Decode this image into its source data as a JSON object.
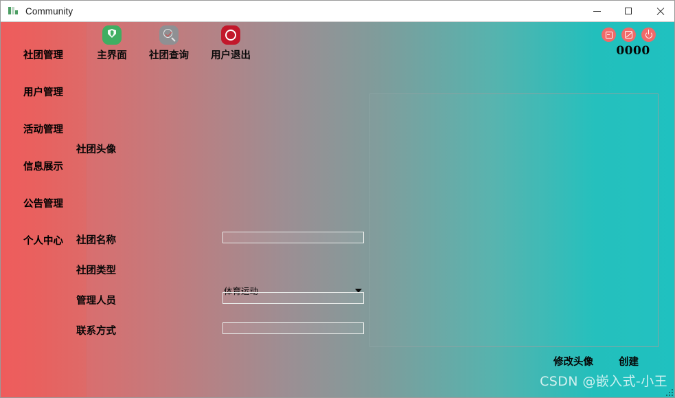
{
  "window": {
    "title": "Community",
    "icon": "app-block-icon",
    "controls": {
      "minimize": "minimize-icon",
      "maximize": "maximize-icon",
      "close": "close-icon"
    }
  },
  "sidebar": {
    "items": [
      {
        "label": "社团管理",
        "name": "sidebar-item-club-management"
      },
      {
        "label": "用户管理",
        "name": "sidebar-item-user-management"
      },
      {
        "label": "活动管理",
        "name": "sidebar-item-activity-management"
      },
      {
        "label": "信息展示",
        "name": "sidebar-item-information-display"
      },
      {
        "label": "公告管理",
        "name": "sidebar-item-announcement-management"
      },
      {
        "label": "个人中心",
        "name": "sidebar-item-personal-center"
      }
    ]
  },
  "toolbar": {
    "buttons": [
      {
        "label": "主界面",
        "icon": "shield-icon"
      },
      {
        "label": "社团查询",
        "icon": "search-icon"
      },
      {
        "label": "用户退出",
        "icon": "record-icon"
      }
    ]
  },
  "corner": {
    "buttons": [
      {
        "icon": "window-minimize-icon"
      },
      {
        "icon": "window-restore-icon"
      },
      {
        "icon": "power-icon"
      }
    ],
    "counter": "0000"
  },
  "form": {
    "avatar_label": "社团头像",
    "fields": [
      {
        "label": "社团名称",
        "type": "text",
        "value": "",
        "placeholder": "",
        "name": "club-name"
      },
      {
        "label": "社团类型",
        "type": "select",
        "value": "体育运动",
        "name": "club-type"
      },
      {
        "label": "管理人员",
        "type": "text",
        "value": "",
        "placeholder": "",
        "name": "club-manager"
      },
      {
        "label": "联系方式",
        "type": "text",
        "value": "",
        "placeholder": "",
        "name": "club-contact"
      }
    ]
  },
  "preview": {
    "content": ""
  },
  "actions": {
    "change_avatar": "修改头像",
    "create": "创建"
  },
  "watermark": "CSDN @嵌入式-小王",
  "colors": {
    "gradient_start": "#ef5c5c",
    "gradient_end": "#1fc1c0",
    "sidebar": "#ef5c5c",
    "corner_button": "#f06a6a",
    "shield_icon": "#3fae62",
    "record_icon": "#c2182b",
    "search_icon": "#8f9093"
  }
}
